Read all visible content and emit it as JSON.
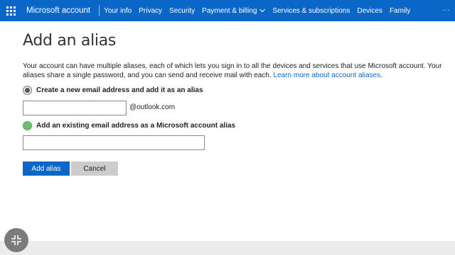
{
  "header": {
    "brand": "Microsoft account",
    "nav": [
      {
        "label": "Your info"
      },
      {
        "label": "Privacy"
      },
      {
        "label": "Security"
      },
      {
        "label": "Payment & billing"
      },
      {
        "label": "Services & subscriptions"
      },
      {
        "label": "Devices"
      },
      {
        "label": "Family"
      }
    ],
    "more_label": "· · ·"
  },
  "page": {
    "title": "Add an alias",
    "description": "Your account can have multiple aliases, each of which lets you sign in to all the devices and services that use Microsoft account. Your aliases share a single password, and you can send and receive mail with each.",
    "learn_more": "Learn more about account aliases."
  },
  "options": {
    "new_email_label": "Create a new email address and add it as an alias",
    "new_email_value": "",
    "domain_suffix": "@outlook.com",
    "existing_email_label": "Add an existing email address as a Microsoft account alias",
    "existing_email_value": ""
  },
  "buttons": {
    "add": "Add alias",
    "cancel": "Cancel"
  },
  "colors": {
    "accent": "#0a67c7",
    "radio_hover": "#6cc070"
  },
  "icons": {
    "app_launcher": "waffle-icon",
    "dropdown": "chevron-down-icon",
    "collapse": "collapse-arrows-icon"
  }
}
